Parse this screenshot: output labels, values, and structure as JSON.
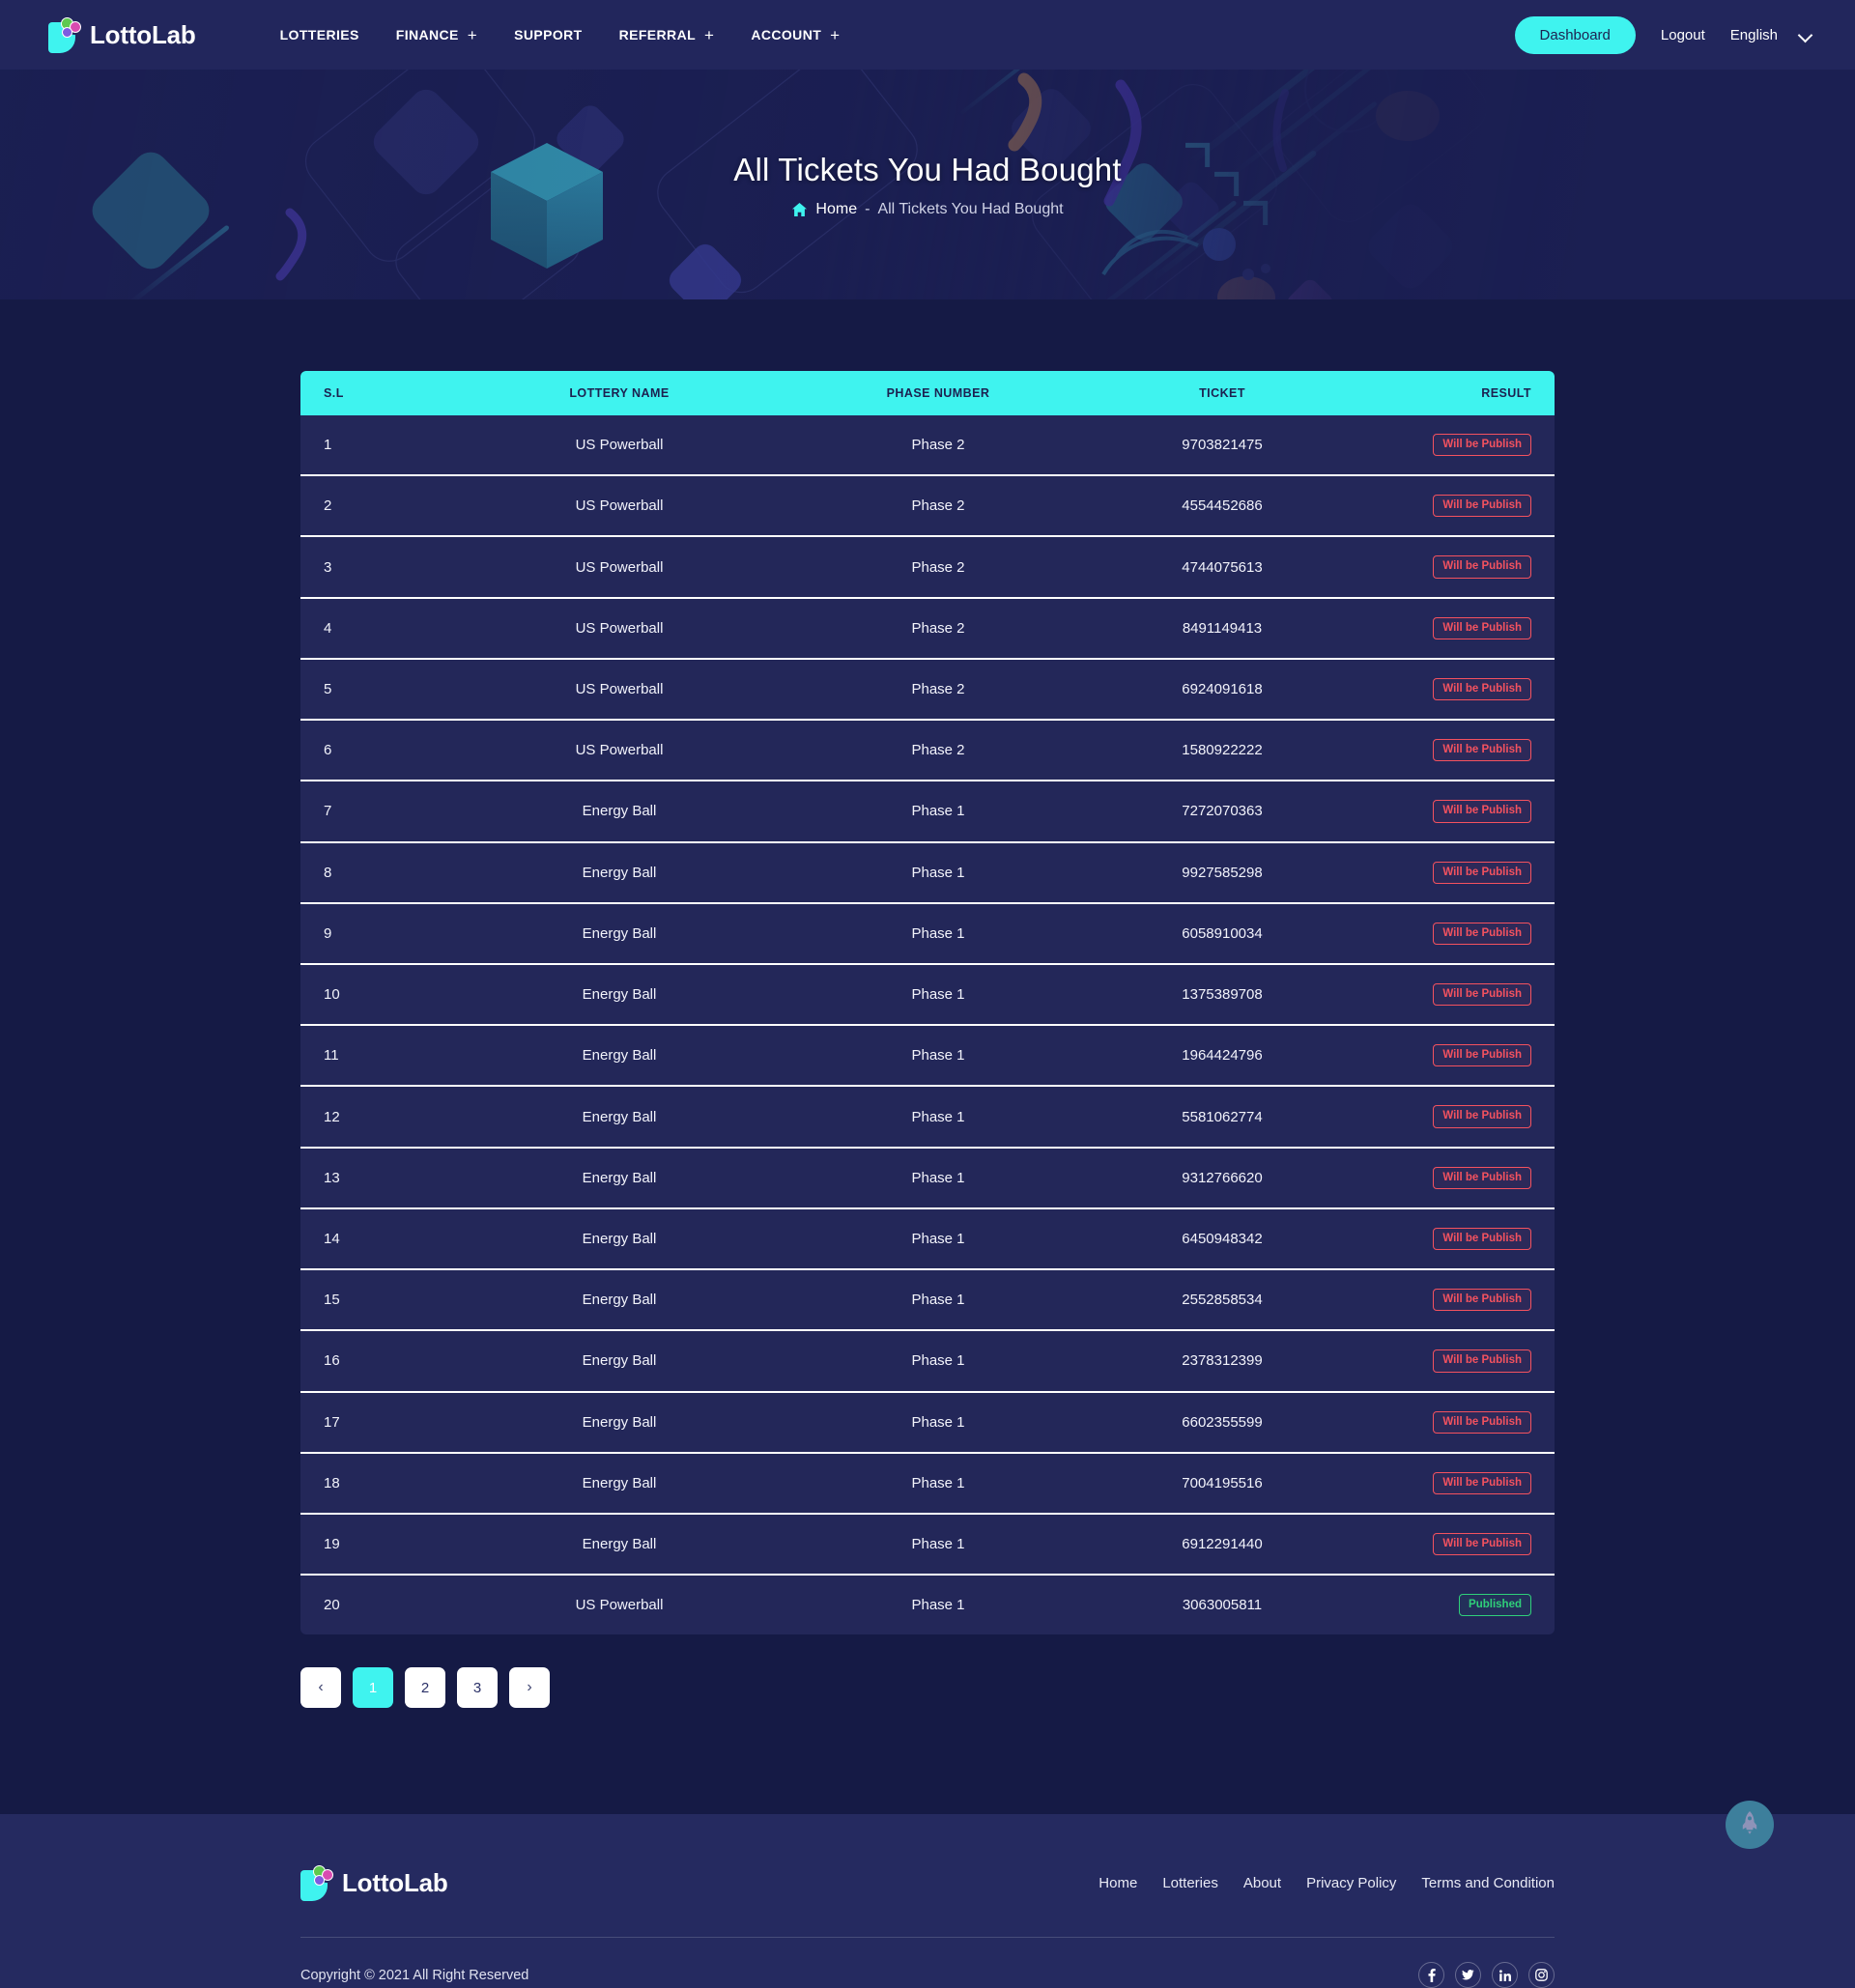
{
  "brand": {
    "name": "LottoLab"
  },
  "header": {
    "nav": [
      {
        "label": "LOTTERIES",
        "has_plus": false
      },
      {
        "label": "FINANCE",
        "has_plus": true
      },
      {
        "label": "SUPPORT",
        "has_plus": false
      },
      {
        "label": "REFERRAL",
        "has_plus": true
      },
      {
        "label": "ACCOUNT",
        "has_plus": true
      }
    ],
    "dashboard_label": "Dashboard",
    "logout_label": "Logout",
    "language_label": "English",
    "plus_glyph": "+"
  },
  "hero": {
    "title": "All Tickets You Had Bought",
    "breadcrumb_home": "Home",
    "breadcrumb_sep": "-",
    "breadcrumb_current": "All Tickets You Had Bought"
  },
  "table": {
    "columns": [
      "S.L",
      "LOTTERY NAME",
      "PHASE NUMBER",
      "TICKET",
      "RESULT"
    ],
    "rows": [
      {
        "sl": "1",
        "lottery": "US Powerball",
        "phase": "Phase 2",
        "ticket": "9703821475",
        "result": "Will be Publish",
        "status": "pending"
      },
      {
        "sl": "2",
        "lottery": "US Powerball",
        "phase": "Phase 2",
        "ticket": "4554452686",
        "result": "Will be Publish",
        "status": "pending"
      },
      {
        "sl": "3",
        "lottery": "US Powerball",
        "phase": "Phase 2",
        "ticket": "4744075613",
        "result": "Will be Publish",
        "status": "pending"
      },
      {
        "sl": "4",
        "lottery": "US Powerball",
        "phase": "Phase 2",
        "ticket": "8491149413",
        "result": "Will be Publish",
        "status": "pending"
      },
      {
        "sl": "5",
        "lottery": "US Powerball",
        "phase": "Phase 2",
        "ticket": "6924091618",
        "result": "Will be Publish",
        "status": "pending"
      },
      {
        "sl": "6",
        "lottery": "US Powerball",
        "phase": "Phase 2",
        "ticket": "1580922222",
        "result": "Will be Publish",
        "status": "pending"
      },
      {
        "sl": "7",
        "lottery": "Energy Ball",
        "phase": "Phase 1",
        "ticket": "7272070363",
        "result": "Will be Publish",
        "status": "pending"
      },
      {
        "sl": "8",
        "lottery": "Energy Ball",
        "phase": "Phase 1",
        "ticket": "9927585298",
        "result": "Will be Publish",
        "status": "pending"
      },
      {
        "sl": "9",
        "lottery": "Energy Ball",
        "phase": "Phase 1",
        "ticket": "6058910034",
        "result": "Will be Publish",
        "status": "pending"
      },
      {
        "sl": "10",
        "lottery": "Energy Ball",
        "phase": "Phase 1",
        "ticket": "1375389708",
        "result": "Will be Publish",
        "status": "pending"
      },
      {
        "sl": "11",
        "lottery": "Energy Ball",
        "phase": "Phase 1",
        "ticket": "1964424796",
        "result": "Will be Publish",
        "status": "pending"
      },
      {
        "sl": "12",
        "lottery": "Energy Ball",
        "phase": "Phase 1",
        "ticket": "5581062774",
        "result": "Will be Publish",
        "status": "pending"
      },
      {
        "sl": "13",
        "lottery": "Energy Ball",
        "phase": "Phase 1",
        "ticket": "9312766620",
        "result": "Will be Publish",
        "status": "pending"
      },
      {
        "sl": "14",
        "lottery": "Energy Ball",
        "phase": "Phase 1",
        "ticket": "6450948342",
        "result": "Will be Publish",
        "status": "pending"
      },
      {
        "sl": "15",
        "lottery": "Energy Ball",
        "phase": "Phase 1",
        "ticket": "2552858534",
        "result": "Will be Publish",
        "status": "pending"
      },
      {
        "sl": "16",
        "lottery": "Energy Ball",
        "phase": "Phase 1",
        "ticket": "2378312399",
        "result": "Will be Publish",
        "status": "pending"
      },
      {
        "sl": "17",
        "lottery": "Energy Ball",
        "phase": "Phase 1",
        "ticket": "6602355599",
        "result": "Will be Publish",
        "status": "pending"
      },
      {
        "sl": "18",
        "lottery": "Energy Ball",
        "phase": "Phase 1",
        "ticket": "7004195516",
        "result": "Will be Publish",
        "status": "pending"
      },
      {
        "sl": "19",
        "lottery": "Energy Ball",
        "phase": "Phase 1",
        "ticket": "6912291440",
        "result": "Will be Publish",
        "status": "pending"
      },
      {
        "sl": "20",
        "lottery": "US Powerball",
        "phase": "Phase 1",
        "ticket": "3063005811",
        "result": "Published",
        "status": "published"
      }
    ]
  },
  "pagination": {
    "prev_glyph": "‹",
    "next_glyph": "›",
    "pages": [
      "1",
      "2",
      "3"
    ],
    "active_page": "1"
  },
  "footer": {
    "links": [
      "Home",
      "Lotteries",
      "About",
      "Privacy Policy",
      "Terms and Condition"
    ],
    "copyright": "Copyright © 2021 All Right Reserved",
    "social": [
      "facebook-icon",
      "twitter-icon",
      "linkedin-icon",
      "instagram-icon"
    ]
  },
  "scroll_top": {
    "icon": "rocket-icon"
  },
  "colors": {
    "accent": "#3ff3ef",
    "page_bg": "#151a45",
    "header_bg": "#22265c",
    "row_bg": "#232759",
    "footer_bg": "#252a60",
    "pending": "#f4525f",
    "published": "#2fd07a"
  }
}
